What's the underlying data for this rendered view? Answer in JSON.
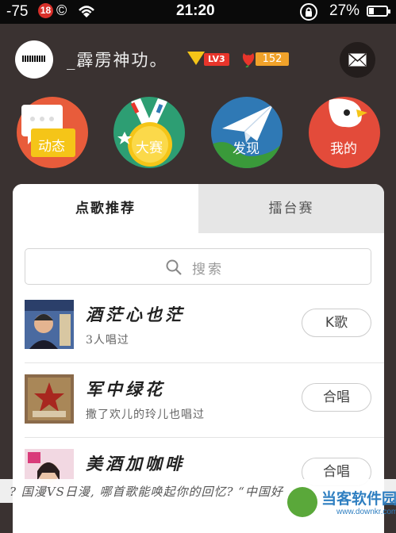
{
  "status_bar": {
    "signal": "-75",
    "badge": "18",
    "copyright_symbol": "©",
    "time": "21:20",
    "battery_percent": "27%",
    "battery_level": 0.27
  },
  "profile": {
    "username": "_霹雳神功。",
    "level": "LV3",
    "flowers": "152"
  },
  "nav": [
    {
      "label": "动态",
      "icon": "chat-bubble-icon"
    },
    {
      "label": "大赛",
      "icon": "medal-icon"
    },
    {
      "label": "发现",
      "icon": "paper-plane-icon"
    },
    {
      "label": "我的",
      "icon": "bird-icon"
    }
  ],
  "tabs": {
    "recommend": "点歌推荐",
    "arena": "擂台赛"
  },
  "search": {
    "placeholder": "搜索"
  },
  "songs": [
    {
      "title": "酒茫心也茫",
      "subtitle": "3人唱过",
      "action": "K歌"
    },
    {
      "title": "军中绿花",
      "subtitle": "撒了欢儿的玲儿也唱过",
      "action": "合唱"
    },
    {
      "title": "美酒加咖啡",
      "subtitle": "",
      "action": "合唱"
    }
  ],
  "ticker": {
    "text": "? 国漫VS日漫, 哪首歌能唤起你的回忆?    “中国好"
  },
  "watermark": {
    "name": "当客软件园",
    "url": "www.downkr.com"
  },
  "colors": {
    "background": "#3a3231",
    "dynamic": "#e85c3b",
    "contest": "#2d9e73",
    "discover": "#2f79b5",
    "mine": "#e34b3a",
    "accent_red": "#e8352b",
    "gold": "#f5c518"
  }
}
